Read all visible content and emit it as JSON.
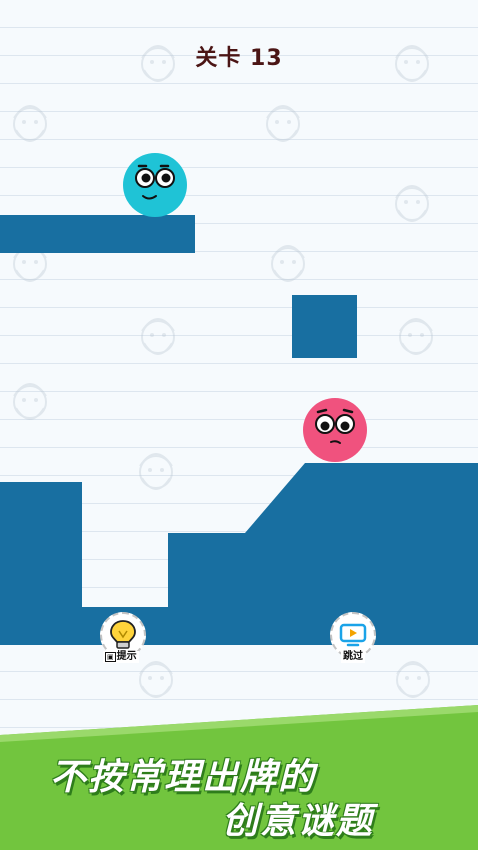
{
  "level": {
    "title": "关卡 13"
  },
  "tools": {
    "hint_label": "提示",
    "skip_label": "跳过"
  },
  "banner": {
    "line1": "不按常理出牌的",
    "line2": "创意谜题"
  },
  "colors": {
    "block": "#186fa1",
    "cyan_ball": "#1fc3d6",
    "pink_ball": "#f0527e",
    "banner_green": "#72c53e",
    "title": "#4b1515"
  }
}
